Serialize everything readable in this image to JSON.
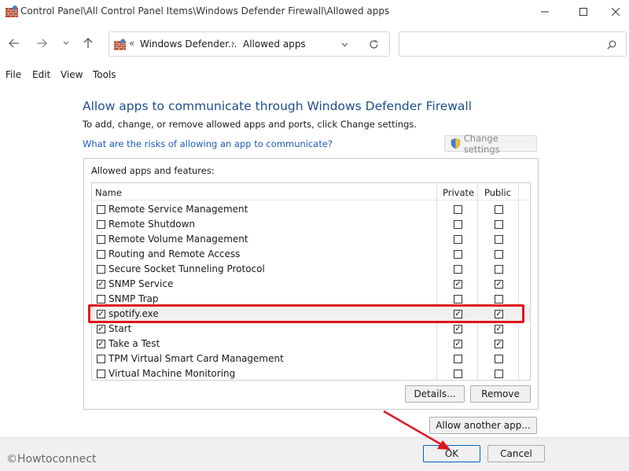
{
  "window": {
    "title": "Control Panel\\All Control Panel Items\\Windows Defender Firewall\\Allowed apps"
  },
  "nav": {
    "crumb_overflow": "«",
    "crumb1": "Windows Defender...",
    "crumb_sep": "›",
    "crumb2": "Allowed apps"
  },
  "menu": [
    "File",
    "Edit",
    "View",
    "Tools"
  ],
  "content": {
    "heading": "Allow apps to communicate through Windows Defender Firewall",
    "subtext": "To add, change, or remove allowed apps and ports, click Change settings.",
    "risk_link": "What are the risks of allowing an app to communicate?",
    "change_settings": "Change settings",
    "group_label": "Allowed apps and features:"
  },
  "list": {
    "headers": {
      "name": "Name",
      "private": "Private",
      "public": "Public"
    },
    "rows": [
      {
        "name": "Remote Service Management",
        "enabled": false,
        "private": false,
        "public": false
      },
      {
        "name": "Remote Shutdown",
        "enabled": false,
        "private": false,
        "public": false
      },
      {
        "name": "Remote Volume Management",
        "enabled": false,
        "private": false,
        "public": false
      },
      {
        "name": "Routing and Remote Access",
        "enabled": false,
        "private": false,
        "public": false
      },
      {
        "name": "Secure Socket Tunneling Protocol",
        "enabled": false,
        "private": false,
        "public": false
      },
      {
        "name": "SNMP Service",
        "enabled": true,
        "private": true,
        "public": true
      },
      {
        "name": "SNMP Trap",
        "enabled": false,
        "private": false,
        "public": false
      },
      {
        "name": "spotify.exe",
        "enabled": true,
        "private": true,
        "public": true,
        "selected": true
      },
      {
        "name": "Start",
        "enabled": true,
        "private": true,
        "public": true
      },
      {
        "name": "Take a Test",
        "enabled": true,
        "private": true,
        "public": true
      },
      {
        "name": "TPM Virtual Smart Card Management",
        "enabled": false,
        "private": false,
        "public": false
      },
      {
        "name": "Virtual Machine Monitoring",
        "enabled": false,
        "private": false,
        "public": false
      }
    ]
  },
  "buttons": {
    "details": "Details...",
    "remove": "Remove",
    "allow_another": "Allow another app...",
    "ok": "OK",
    "cancel": "Cancel"
  },
  "watermark": "©Howtoconnect",
  "colors": {
    "heading": "#1e4e8c",
    "link": "#1e5bb8",
    "highlight": "#e0141e",
    "arrow": "#e0141e"
  }
}
